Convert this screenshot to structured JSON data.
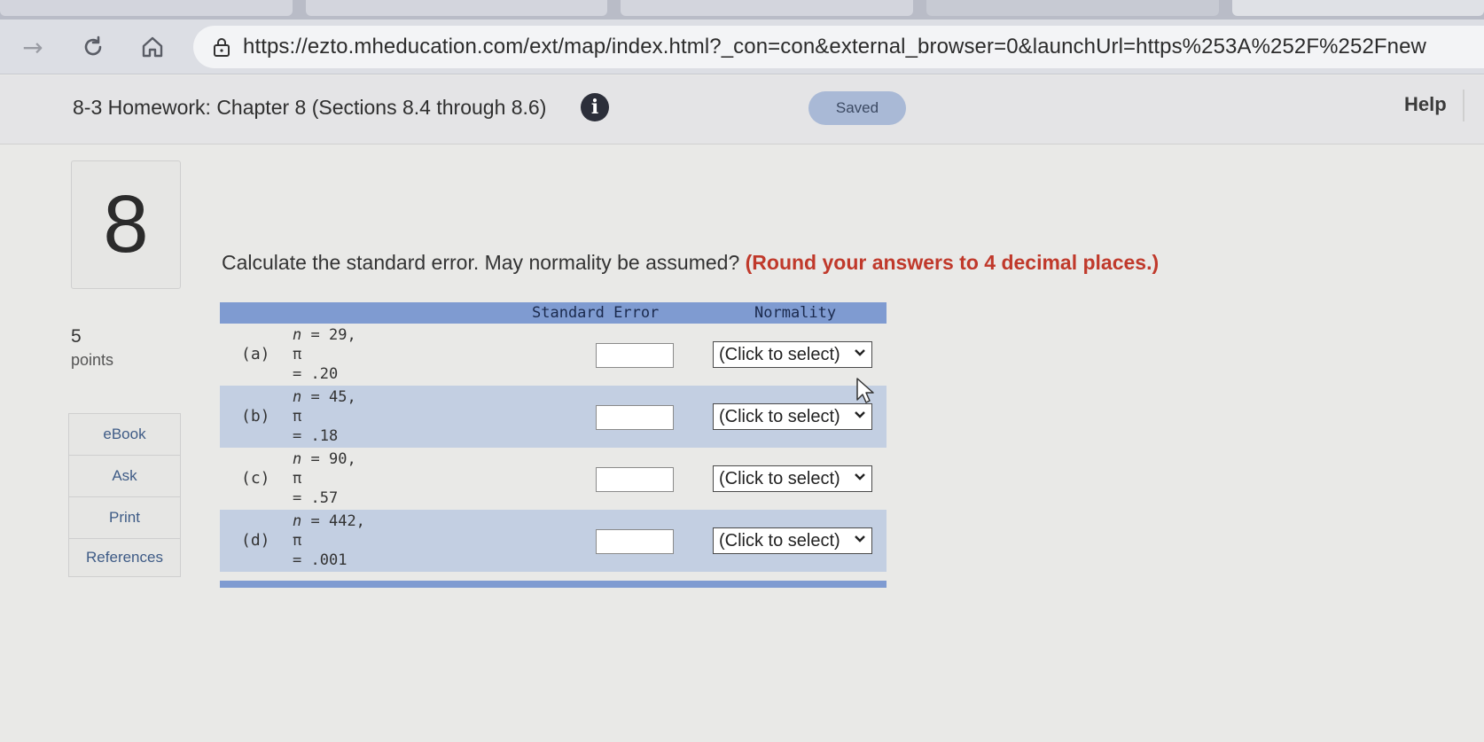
{
  "browser": {
    "url": "https://ezto.mheducation.com/ext/map/index.html?_con=con&external_browser=0&launchUrl=https%253A%252F%252Fnew"
  },
  "header": {
    "title": "8-3 Homework: Chapter 8 (Sections 8.4 through 8.6)",
    "status": "Saved",
    "help": "Help"
  },
  "question": {
    "number": "8",
    "points_value": "5",
    "points_label": "points",
    "prompt": "Calculate the standard error. May normality be assumed?",
    "instruction": "(Round your answers to 4 decimal places.)"
  },
  "side_menu": [
    "eBook",
    "Ask",
    "Print",
    "References"
  ],
  "table": {
    "col_se": "Standard Error",
    "col_norm": "Normality",
    "rows": [
      {
        "label": "(a)",
        "n": "29,",
        "pi": ".20",
        "select": "(Click to select)"
      },
      {
        "label": "(b)",
        "n": "45,",
        "pi": ".18",
        "select": "(Click to select)"
      },
      {
        "label": "(c)",
        "n": "90,",
        "pi": ".57",
        "select": "(Click to select)"
      },
      {
        "label": "(d)",
        "n": "442,",
        "pi": ".001",
        "select": "(Click to select)"
      }
    ]
  },
  "colors": {
    "table_header": "#7f9bd1",
    "row_alt": "#c3cfe2",
    "instruction": "#c0392b"
  }
}
